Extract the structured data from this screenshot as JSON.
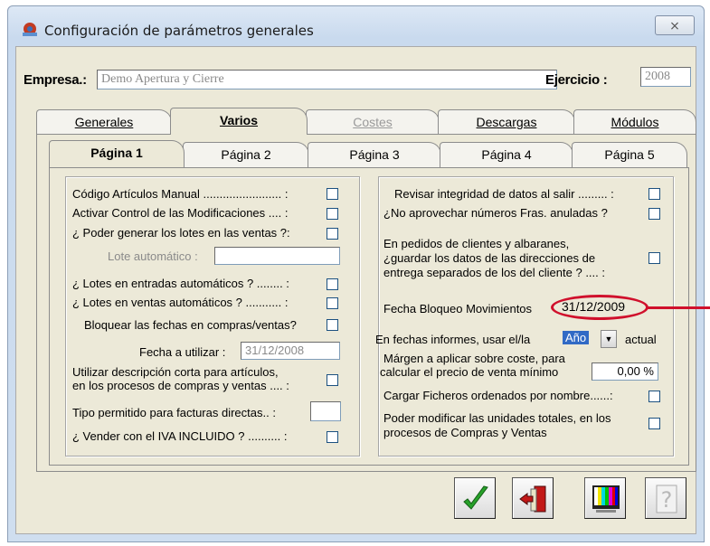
{
  "window": {
    "title": "Configuración de parámetros generales",
    "close_glyph": "⨯"
  },
  "header": {
    "empresa_label": "Empresa.:",
    "empresa_value": "Demo Apertura y Cierre",
    "ejercicio_label": "Ejercicio :",
    "ejercicio_value": "2008"
  },
  "main_tabs": [
    "Generales",
    "Varios",
    "Costes",
    "Descargas",
    "Módulos"
  ],
  "sub_tabs": [
    "Página 1",
    "Página 2",
    "Página 3",
    "Página 4",
    "Página 5"
  ],
  "left_panel": {
    "codigo_manual": "Código Artículos Manual ........................ :",
    "control_modificaciones": "Activar Control de las Modificaciones .... :",
    "lotes_ventas_q": "¿ Poder generar los lotes en las ventas ?:",
    "lote_automatico": "Lote automático :",
    "lotes_entradas": "¿ Lotes en entradas automáticos ? ........ :",
    "lotes_ventas_auto": "¿ Lotes en ventas automáticos ? ........... :",
    "bloquear_fechas": "Bloquear las fechas en compras/ventas?",
    "fecha_utilizar_label": "Fecha a utilizar :",
    "fecha_utilizar_value": "31/12/2008",
    "descripcion_corta_1": "Utilizar descripción corta para artículos,",
    "descripcion_corta_2": "en los procesos de compras y ventas .... :",
    "tipo_facturas": "Tipo permitido para facturas directas.. :",
    "iva_incluido": "¿ Vender con el IVA INCLUIDO ? .......... :"
  },
  "right_panel": {
    "revisar_integridad": "Revisar integridad de datos al salir ......... :",
    "no_aprovechar": "¿No aprovechar números Fras. anuladas ?",
    "pedidos_1": "En pedidos de clientes y albaranes,",
    "pedidos_2": "¿guardar los datos de las direcciones de",
    "pedidos_3": "entrega separados de los del cliente ? .... :",
    "fecha_bloqueo_label": "Fecha Bloqueo Movimientos",
    "fecha_bloqueo_value": "31/12/2009",
    "fechas_informes_label": "En fechas informes, usar el/la",
    "fechas_informes_value": "Año",
    "fechas_informes_suffix": "actual",
    "margen_1": "Márgen a aplicar sobre coste, para",
    "margen_2": "calcular el precio de venta mínimo",
    "margen_value": "0,00 %",
    "cargar_ficheros": "Cargar Ficheros ordenados por nombre......:",
    "unidades_1": "Poder modificar las unidades totales, en los",
    "unidades_2": "procesos de Compras y Ventas"
  },
  "colors": {
    "accent": "#316ac5",
    "highlight": "#d0102c",
    "ok_green": "#27a12a"
  },
  "buttons": [
    "check-icon",
    "exit-door-icon",
    "tv-test-icon",
    "help-icon"
  ]
}
